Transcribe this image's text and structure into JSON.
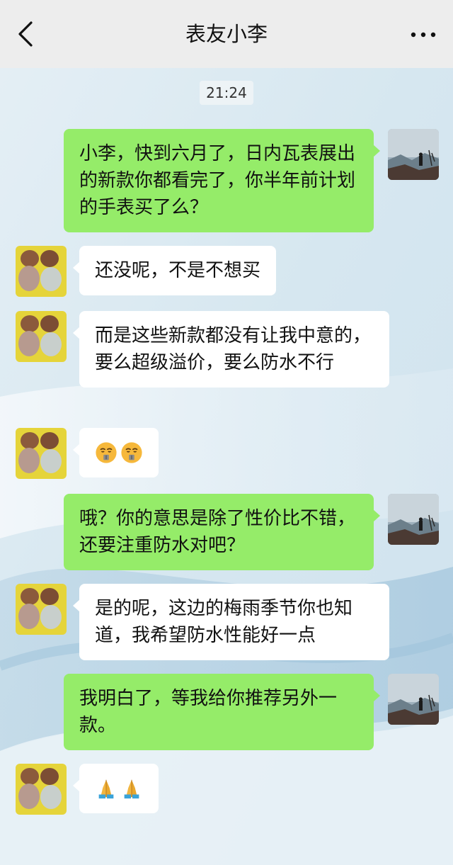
{
  "header": {
    "title": "表友小李",
    "back_icon": "chevron-left-icon",
    "more_icon": "ellipsis-icon"
  },
  "chat": {
    "timestamp": "21:24",
    "messages": [
      {
        "from": "me",
        "text": "小李，快到六月了，日内瓦表展出的新款你都看完了，你半年前计划的手表买了么？"
      },
      {
        "from": "friend",
        "text": "还没呢，不是不想买"
      },
      {
        "from": "friend",
        "text": "而是这些新款都没有让我中意的，要么超级溢价，要么防水不行"
      },
      {
        "from": "friend",
        "emoji": [
          "face-with-zipper-sweat-icon",
          "face-with-zipper-sweat-icon"
        ]
      },
      {
        "from": "me",
        "text": "哦？你的意思是除了性价比不错，还要注重防水对吧？"
      },
      {
        "from": "friend",
        "text": "是的呢，这边的梅雨季节你也知道，我希望防水性能好一点"
      },
      {
        "from": "me",
        "text": "我明白了，等我给你推荐另外一款。"
      },
      {
        "from": "friend",
        "emoji": [
          "folded-hands-icon",
          "folded-hands-icon"
        ]
      }
    ]
  },
  "colors": {
    "outgoing_bubble": "#95ec69",
    "incoming_bubble": "#ffffff",
    "header_bg": "#ededed"
  }
}
